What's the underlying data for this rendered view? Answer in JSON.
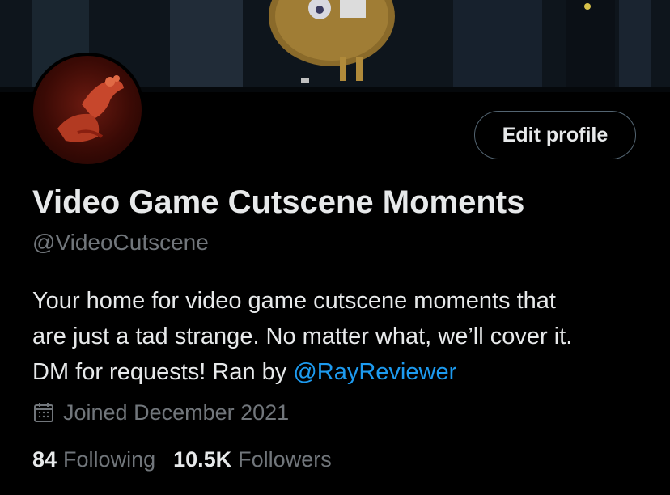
{
  "profile": {
    "display_name": "Video Game Cutscene Moments",
    "handle": "@VideoCutscene",
    "edit_button_label": "Edit profile",
    "bio": {
      "line1": "Your home for video game cutscene moments that",
      "line2": "are just a tad strange. No matter what, we’ll cover it.",
      "line3_prefix": "DM for requests! Ran by ",
      "mention": "@RayReviewer"
    },
    "joined_text": "Joined December 2021",
    "following_count": "84",
    "following_label": "Following",
    "followers_count": "10.5K",
    "followers_label": "Followers"
  },
  "icons": {
    "calendar": "calendar-icon"
  },
  "colors": {
    "background": "#000000",
    "text_primary": "#e7e9ea",
    "text_secondary": "#71767b",
    "link": "#1d9bf0",
    "button_border": "#536471"
  }
}
